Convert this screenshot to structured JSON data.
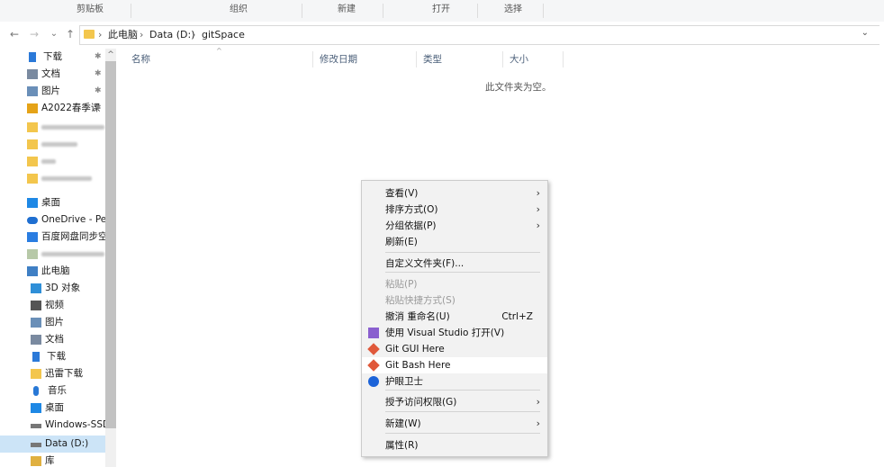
{
  "ribbon": {
    "groups": [
      "剪贴板",
      "组织",
      "新建",
      "打开",
      "选择"
    ]
  },
  "address": {
    "back": "←",
    "forward": "→",
    "recent": "⌄",
    "up": "↑",
    "crumbs": [
      "此电脑",
      "Data (D:)",
      "gitSpace"
    ],
    "separator": "›",
    "dropdown": "⌄"
  },
  "nav": {
    "scroll_up": "^",
    "pin": "✱",
    "items": [
      {
        "label": "下载",
        "icon": "download-icon",
        "pinned": true
      },
      {
        "label": "文档",
        "icon": "document-icon",
        "pinned": true
      },
      {
        "label": "图片",
        "icon": "picture-icon",
        "pinned": true
      },
      {
        "label": "A2022春季课",
        "icon": "colorful-logo-icon",
        "pinned": true
      },
      {
        "label": "",
        "icon": "folder-icon"
      },
      {
        "label": "",
        "icon": "folder-icon"
      },
      {
        "label": "",
        "icon": "folder-icon"
      },
      {
        "label": "",
        "icon": "folder-icon"
      },
      {
        "label": "桌面",
        "icon": "desktop-icon"
      },
      {
        "label": "OneDrive - Pers",
        "icon": "cloud-icon"
      },
      {
        "label": "百度网盘同步空间",
        "icon": "baidu-sync-icon"
      },
      {
        "label": "",
        "icon": "user-folder-icon"
      },
      {
        "label": "此电脑",
        "icon": "this-pc-icon"
      },
      {
        "label": "3D 对象",
        "icon": "3d-objects-icon"
      },
      {
        "label": "视频",
        "icon": "video-icon"
      },
      {
        "label": "图片",
        "icon": "picture-icon"
      },
      {
        "label": "文档",
        "icon": "document-icon"
      },
      {
        "label": "下载",
        "icon": "download-icon"
      },
      {
        "label": "迅雷下载",
        "icon": "folder-icon"
      },
      {
        "label": "音乐",
        "icon": "music-icon"
      },
      {
        "label": "桌面",
        "icon": "desktop-icon"
      },
      {
        "label": "Windows-SSD",
        "icon": "drive-icon"
      },
      {
        "label": "Data (D:)",
        "icon": "drive-icon",
        "selected": true
      },
      {
        "label": "库",
        "icon": "library-icon"
      }
    ]
  },
  "columns": [
    "名称",
    "修改日期",
    "类型",
    "大小"
  ],
  "empty_message": "此文件夹为空。",
  "context_menu": {
    "items": [
      {
        "label": "查看(V)",
        "submenu": true
      },
      {
        "label": "排序方式(O)",
        "submenu": true
      },
      {
        "label": "分组依据(P)",
        "submenu": true
      },
      {
        "label": "刷新(E)"
      },
      {
        "label": "自定义文件夹(F)..."
      },
      {
        "label": "粘贴(P)",
        "disabled": true
      },
      {
        "label": "粘贴快捷方式(S)",
        "disabled": true
      },
      {
        "label": "撤消 重命名(U)",
        "shortcut": "Ctrl+Z"
      },
      {
        "label": "使用 Visual Studio 打开(V)",
        "icon": "visual-studio-icon"
      },
      {
        "label": "Git GUI Here",
        "icon": "git-icon"
      },
      {
        "label": "Git Bash Here",
        "icon": "git-icon",
        "hover": true
      },
      {
        "label": "护眼卫士",
        "icon": "eye-guard-icon"
      },
      {
        "label": "授予访问权限(G)",
        "submenu": true
      },
      {
        "label": "新建(W)",
        "submenu": true
      },
      {
        "label": "属性(R)"
      }
    ],
    "submenu_arrow": "›"
  },
  "colors": {
    "selection": "#cce4f7",
    "menu_bg": "#f2f2f2",
    "folder": "#f3c64d",
    "accent": "#0078d7"
  }
}
